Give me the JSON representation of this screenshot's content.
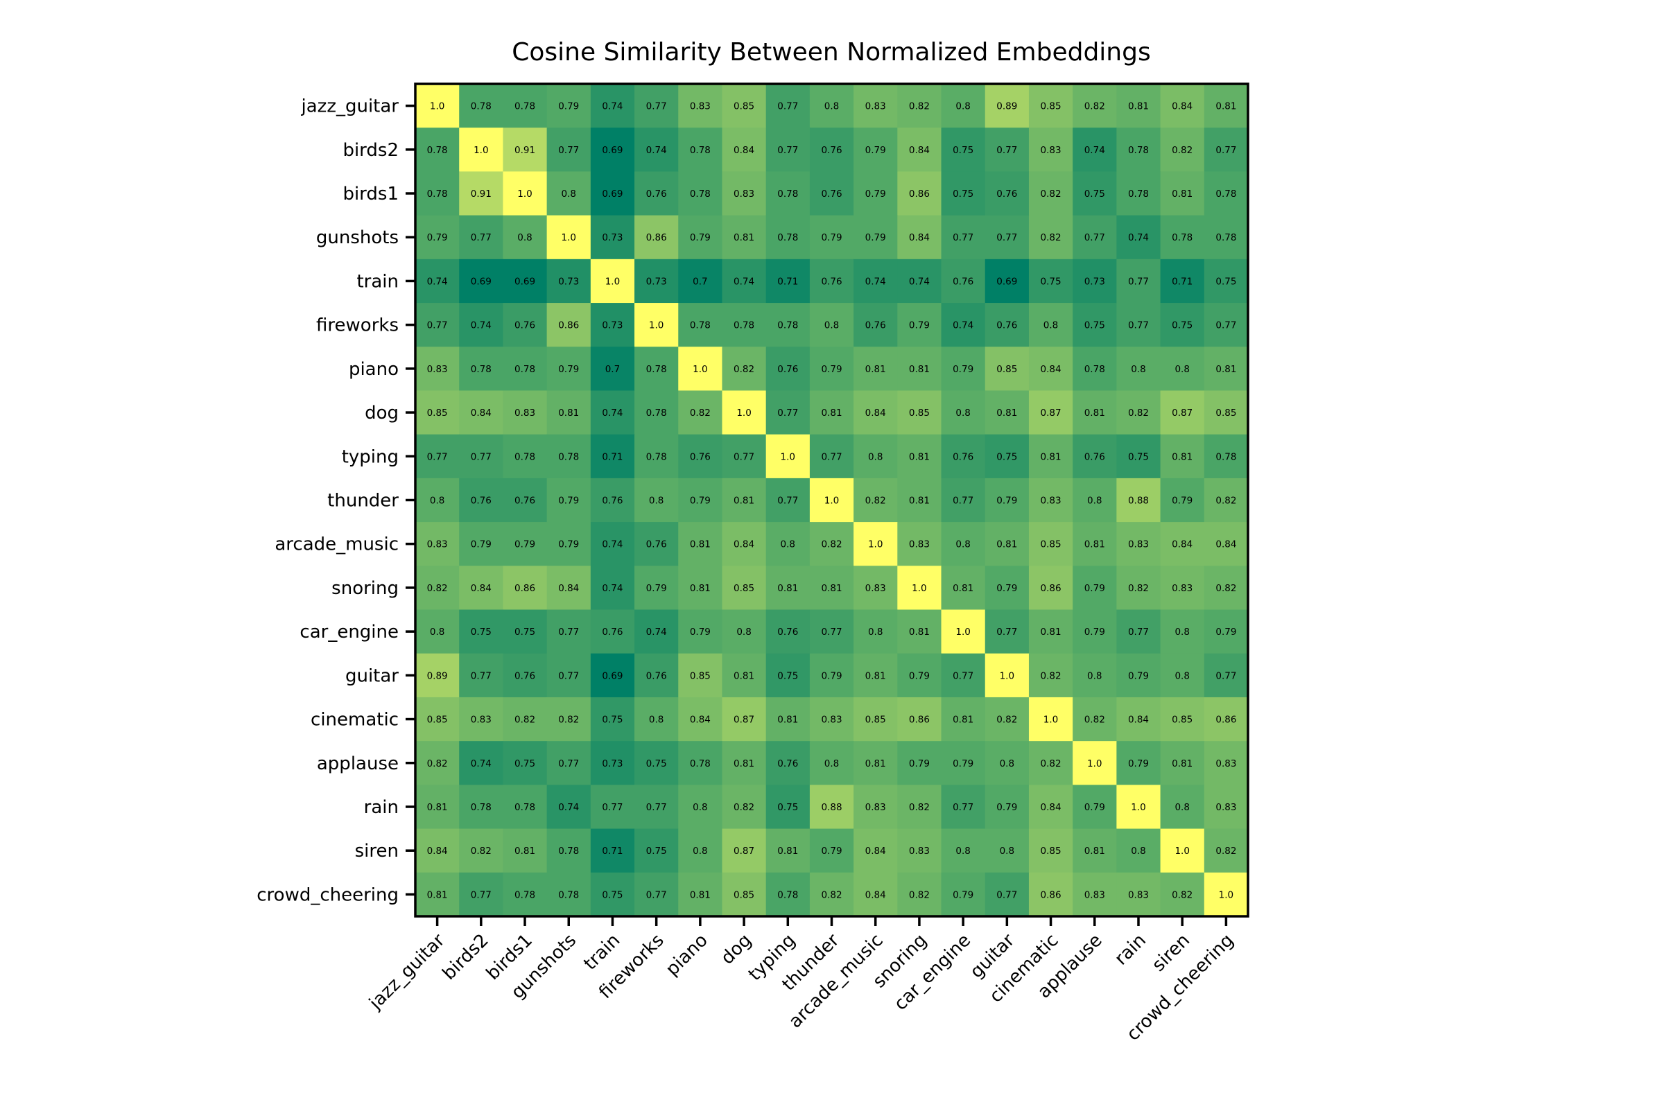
{
  "chart_data": {
    "type": "heatmap",
    "title": "Cosine Similarity Between Normalized Embeddings",
    "xlabel": "",
    "ylabel": "",
    "colormap": "summer",
    "value_range": [
      0.69,
      1.0
    ],
    "color_low": "#007f66",
    "color_high": "#ffff66",
    "x_tick_rotation_deg": 45,
    "labels": [
      "jazz_guitar",
      "birds2",
      "birds1",
      "gunshots",
      "train",
      "fireworks",
      "piano",
      "dog",
      "typing",
      "thunder",
      "arcade_music",
      "snoring",
      "car_engine",
      "guitar",
      "cinematic",
      "applause",
      "rain",
      "siren",
      "crowd_cheering"
    ],
    "matrix": [
      [
        "1.0",
        "0.78",
        "0.78",
        "0.79",
        "0.74",
        "0.77",
        "0.83",
        "0.85",
        "0.77",
        "0.8",
        "0.83",
        "0.82",
        "0.8",
        "0.89",
        "0.85",
        "0.82",
        "0.81",
        "0.84",
        "0.81"
      ],
      [
        "0.78",
        "1.0",
        "0.91",
        "0.77",
        "0.69",
        "0.74",
        "0.78",
        "0.84",
        "0.77",
        "0.76",
        "0.79",
        "0.84",
        "0.75",
        "0.77",
        "0.83",
        "0.74",
        "0.78",
        "0.82",
        "0.77"
      ],
      [
        "0.78",
        "0.91",
        "1.0",
        "0.8",
        "0.69",
        "0.76",
        "0.78",
        "0.83",
        "0.78",
        "0.76",
        "0.79",
        "0.86",
        "0.75",
        "0.76",
        "0.82",
        "0.75",
        "0.78",
        "0.81",
        "0.78"
      ],
      [
        "0.79",
        "0.77",
        "0.8",
        "1.0",
        "0.73",
        "0.86",
        "0.79",
        "0.81",
        "0.78",
        "0.79",
        "0.79",
        "0.84",
        "0.77",
        "0.77",
        "0.82",
        "0.77",
        "0.74",
        "0.78",
        "0.78"
      ],
      [
        "0.74",
        "0.69",
        "0.69",
        "0.73",
        "1.0",
        "0.73",
        "0.7",
        "0.74",
        "0.71",
        "0.76",
        "0.74",
        "0.74",
        "0.76",
        "0.69",
        "0.75",
        "0.73",
        "0.77",
        "0.71",
        "0.75"
      ],
      [
        "0.77",
        "0.74",
        "0.76",
        "0.86",
        "0.73",
        "1.0",
        "0.78",
        "0.78",
        "0.78",
        "0.8",
        "0.76",
        "0.79",
        "0.74",
        "0.76",
        "0.8",
        "0.75",
        "0.77",
        "0.75",
        "0.77"
      ],
      [
        "0.83",
        "0.78",
        "0.78",
        "0.79",
        "0.7",
        "0.78",
        "1.0",
        "0.82",
        "0.76",
        "0.79",
        "0.81",
        "0.81",
        "0.79",
        "0.85",
        "0.84",
        "0.78",
        "0.8",
        "0.8",
        "0.81"
      ],
      [
        "0.85",
        "0.84",
        "0.83",
        "0.81",
        "0.74",
        "0.78",
        "0.82",
        "1.0",
        "0.77",
        "0.81",
        "0.84",
        "0.85",
        "0.8",
        "0.81",
        "0.87",
        "0.81",
        "0.82",
        "0.87",
        "0.85"
      ],
      [
        "0.77",
        "0.77",
        "0.78",
        "0.78",
        "0.71",
        "0.78",
        "0.76",
        "0.77",
        "1.0",
        "0.77",
        "0.8",
        "0.81",
        "0.76",
        "0.75",
        "0.81",
        "0.76",
        "0.75",
        "0.81",
        "0.78"
      ],
      [
        "0.8",
        "0.76",
        "0.76",
        "0.79",
        "0.76",
        "0.8",
        "0.79",
        "0.81",
        "0.77",
        "1.0",
        "0.82",
        "0.81",
        "0.77",
        "0.79",
        "0.83",
        "0.8",
        "0.88",
        "0.79",
        "0.82"
      ],
      [
        "0.83",
        "0.79",
        "0.79",
        "0.79",
        "0.74",
        "0.76",
        "0.81",
        "0.84",
        "0.8",
        "0.82",
        "1.0",
        "0.83",
        "0.8",
        "0.81",
        "0.85",
        "0.81",
        "0.83",
        "0.84",
        "0.84"
      ],
      [
        "0.82",
        "0.84",
        "0.86",
        "0.84",
        "0.74",
        "0.79",
        "0.81",
        "0.85",
        "0.81",
        "0.81",
        "0.83",
        "1.0",
        "0.81",
        "0.79",
        "0.86",
        "0.79",
        "0.82",
        "0.83",
        "0.82"
      ],
      [
        "0.8",
        "0.75",
        "0.75",
        "0.77",
        "0.76",
        "0.74",
        "0.79",
        "0.8",
        "0.76",
        "0.77",
        "0.8",
        "0.81",
        "1.0",
        "0.77",
        "0.81",
        "0.79",
        "0.77",
        "0.8",
        "0.79"
      ],
      [
        "0.89",
        "0.77",
        "0.76",
        "0.77",
        "0.69",
        "0.76",
        "0.85",
        "0.81",
        "0.75",
        "0.79",
        "0.81",
        "0.79",
        "0.77",
        "1.0",
        "0.82",
        "0.8",
        "0.79",
        "0.8",
        "0.77"
      ],
      [
        "0.85",
        "0.83",
        "0.82",
        "0.82",
        "0.75",
        "0.8",
        "0.84",
        "0.87",
        "0.81",
        "0.83",
        "0.85",
        "0.86",
        "0.81",
        "0.82",
        "1.0",
        "0.82",
        "0.84",
        "0.85",
        "0.86"
      ],
      [
        "0.82",
        "0.74",
        "0.75",
        "0.77",
        "0.73",
        "0.75",
        "0.78",
        "0.81",
        "0.76",
        "0.8",
        "0.81",
        "0.79",
        "0.79",
        "0.8",
        "0.82",
        "1.0",
        "0.79",
        "0.81",
        "0.83"
      ],
      [
        "0.81",
        "0.78",
        "0.78",
        "0.74",
        "0.77",
        "0.77",
        "0.8",
        "0.82",
        "0.75",
        "0.88",
        "0.83",
        "0.82",
        "0.77",
        "0.79",
        "0.84",
        "0.79",
        "1.0",
        "0.8",
        "0.83"
      ],
      [
        "0.84",
        "0.82",
        "0.81",
        "0.78",
        "0.71",
        "0.75",
        "0.8",
        "0.87",
        "0.81",
        "0.79",
        "0.84",
        "0.83",
        "0.8",
        "0.8",
        "0.85",
        "0.81",
        "0.8",
        "1.0",
        "0.82"
      ],
      [
        "0.81",
        "0.77",
        "0.78",
        "0.78",
        "0.75",
        "0.77",
        "0.81",
        "0.85",
        "0.78",
        "0.82",
        "0.84",
        "0.82",
        "0.79",
        "0.77",
        "0.86",
        "0.83",
        "0.83",
        "0.82",
        "1.0"
      ]
    ],
    "grid": false,
    "legend": "none"
  }
}
